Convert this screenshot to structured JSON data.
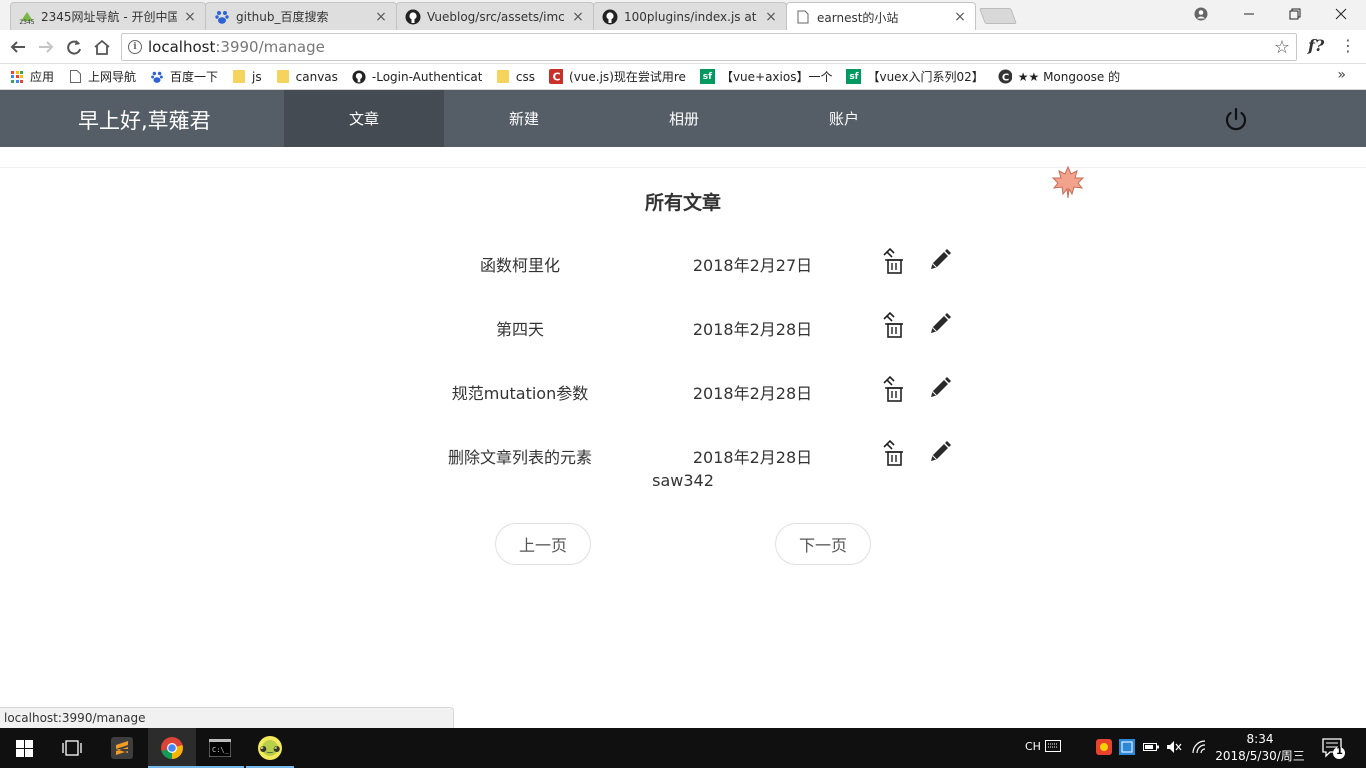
{
  "browser": {
    "tabs": [
      {
        "title": "2345网址导航 - 开创中国",
        "icon": "2345-favicon"
      },
      {
        "title": "github_百度搜索",
        "icon": "baidu-paw-favicon"
      },
      {
        "title": "Vueblog/src/assets/imc",
        "icon": "github-favicon"
      },
      {
        "title": "100plugins/index.js at m",
        "icon": "github-favicon"
      },
      {
        "title": "earnest的小站",
        "icon": "page-favicon"
      }
    ],
    "active_tab_index": 4,
    "url_host": "localhost",
    "url_path": ":3990/manage",
    "bookmarks": [
      {
        "label": "应用",
        "icon": "apps-grid-icon"
      },
      {
        "label": "上网导航",
        "icon": "page-icon"
      },
      {
        "label": "百度一下",
        "icon": "baidu-paw-icon"
      },
      {
        "label": "js",
        "icon": "folder-icon"
      },
      {
        "label": "canvas",
        "icon": "folder-icon"
      },
      {
        "label": "-Login-Authenticat",
        "icon": "github-icon"
      },
      {
        "label": "css",
        "icon": "folder-icon"
      },
      {
        "label": "(vue.js)现在尝试用re",
        "icon": "c-icon"
      },
      {
        "label": "【vue+axios】一个",
        "icon": "sf-icon"
      },
      {
        "label": "【vuex入门系列02】",
        "icon": "sf-icon"
      },
      {
        "label": "★★ Mongoose 的",
        "icon": "c-icon"
      }
    ],
    "ext_label": "f?",
    "status_url": "localhost:3990/manage"
  },
  "app": {
    "greeting": "早上好,草薙君",
    "nav": [
      "文章",
      "新建",
      "相册",
      "账户"
    ],
    "active_nav_index": 0,
    "page_title": "所有文章",
    "articles": [
      {
        "title": "函数柯里化",
        "date": "2018年2月27日"
      },
      {
        "title": "第四天",
        "date": "2018年2月28日"
      },
      {
        "title": "规范mutation参数",
        "date": "2018年2月28日"
      },
      {
        "title": "删除文章列表的元素",
        "date": "2018年2月28日"
      }
    ],
    "author": "saw342",
    "prev_label": "上一页",
    "next_label": "下一页"
  },
  "taskbar": {
    "ime": "CH",
    "time": "8:34",
    "date": "2018/5/30/周三",
    "notification_count": "1"
  },
  "colors": {
    "navbar": "#555d66",
    "navbar_active": "#444b52",
    "taskbar": "#101010"
  }
}
